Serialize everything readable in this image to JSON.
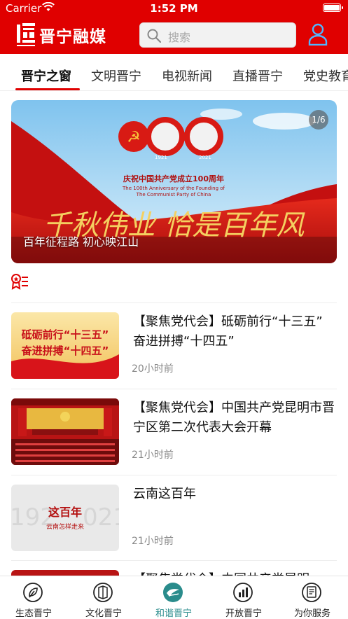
{
  "status_bar": {
    "carrier": "Carrier",
    "time": "1:52 PM"
  },
  "header": {
    "app_name": "晋宁融媒",
    "search_placeholder": "搜索",
    "brand_color": "#e00000"
  },
  "tabs": [
    {
      "label": "晋宁之窗",
      "active": true
    },
    {
      "label": "文明晋宁",
      "active": false
    },
    {
      "label": "电视新闻",
      "active": false
    },
    {
      "label": "直播晋宁",
      "active": false
    },
    {
      "label": "党史教育",
      "active": false
    }
  ],
  "banner": {
    "caption": "百年征程路 初心映江山",
    "counter": "1/6",
    "art": {
      "big_number": "100",
      "year_left": "1921",
      "year_right": "2021",
      "cn_title": "庆祝中国共产党成立100周年",
      "en_line1": "The 100th Anniversary of the Founding of",
      "en_line2": "The Communist Party of China",
      "calligraphy": "千秋伟业 恰是百年风"
    }
  },
  "news": [
    {
      "title": "【聚焦党代会】砥砺前行“十三五” 奋进拼搏“十四五”",
      "time": "20小时前",
      "thumb_line1": "砥砺前行“十三五”",
      "thumb_line2": "奋进拼搏“十四五”"
    },
    {
      "title": "【聚焦党代会】中国共产党昆明市晋宁区第二次代表大会开幕",
      "time": "21小时前"
    },
    {
      "title": "云南这百年",
      "time": "21小时前",
      "thumb_line1": "这百年",
      "thumb_line2": "云南怎样走来",
      "thumb_bg_left": "192",
      "thumb_bg_right": "021"
    },
    {
      "title": "【聚焦党代会】中国共产党昆明",
      "time": ""
    }
  ],
  "bottom_nav": [
    {
      "label": "生态晋宁",
      "icon": "ecology-icon",
      "active": false
    },
    {
      "label": "文化晋宁",
      "icon": "culture-icon",
      "active": false
    },
    {
      "label": "和谐晋宁",
      "icon": "harmony-icon",
      "active": true
    },
    {
      "label": "开放晋宁",
      "icon": "open-icon",
      "active": false
    },
    {
      "label": "为你服务",
      "icon": "service-icon",
      "active": false
    }
  ],
  "accent_color": "#2a8c8c"
}
